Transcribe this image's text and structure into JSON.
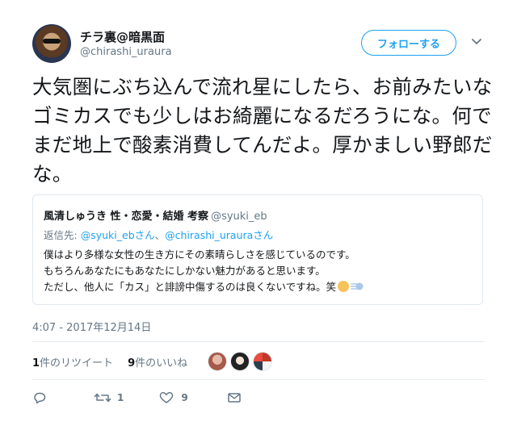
{
  "author": {
    "display_name": "チラ裏@暗黒面",
    "handle": "@chirashi_uraura",
    "follow_label": "フォローする"
  },
  "tweet": {
    "text": "大気圏にぶち込んで流れ星にしたら、お前みたいなゴミカスでも少しはお綺麗になるだろうにな。何でまだ地上で酸素消費してんだよ。厚かましい野郎だな。",
    "timestamp": "4:07 - 2017年12月14日"
  },
  "quote": {
    "name": "風清しゅうき 性・恋愛・結婚 考察",
    "handle": "@syuki_eb",
    "reply_prefix": "返信先:",
    "reply_user1": "@syuki_ebさん",
    "reply_sep": "、",
    "reply_user2": "@chirashi_urauraさん",
    "line1": "僕はより多様な女性の生き方にその素晴らしさを感じているのです。",
    "line2": "もちろんあなたにもあなたにしかない魅力があると思います。",
    "line3": "ただし、他人に「カス」と誹謗中傷するのは良くないですね。笑"
  },
  "stats": {
    "retweet_count": "1",
    "retweet_label": "件のリツイート",
    "like_count": "9",
    "like_label": "件のいいね"
  },
  "actions": {
    "retweet_count": "1",
    "like_count": "9"
  },
  "icons": {
    "reply": "reply-icon",
    "retweet": "retweet-icon",
    "like": "heart-icon",
    "dm": "envelope-icon",
    "more": "chevron-down-icon"
  },
  "colors": {
    "accent": "#1da1f2",
    "muted": "#657786",
    "border": "#e1e8ed"
  }
}
